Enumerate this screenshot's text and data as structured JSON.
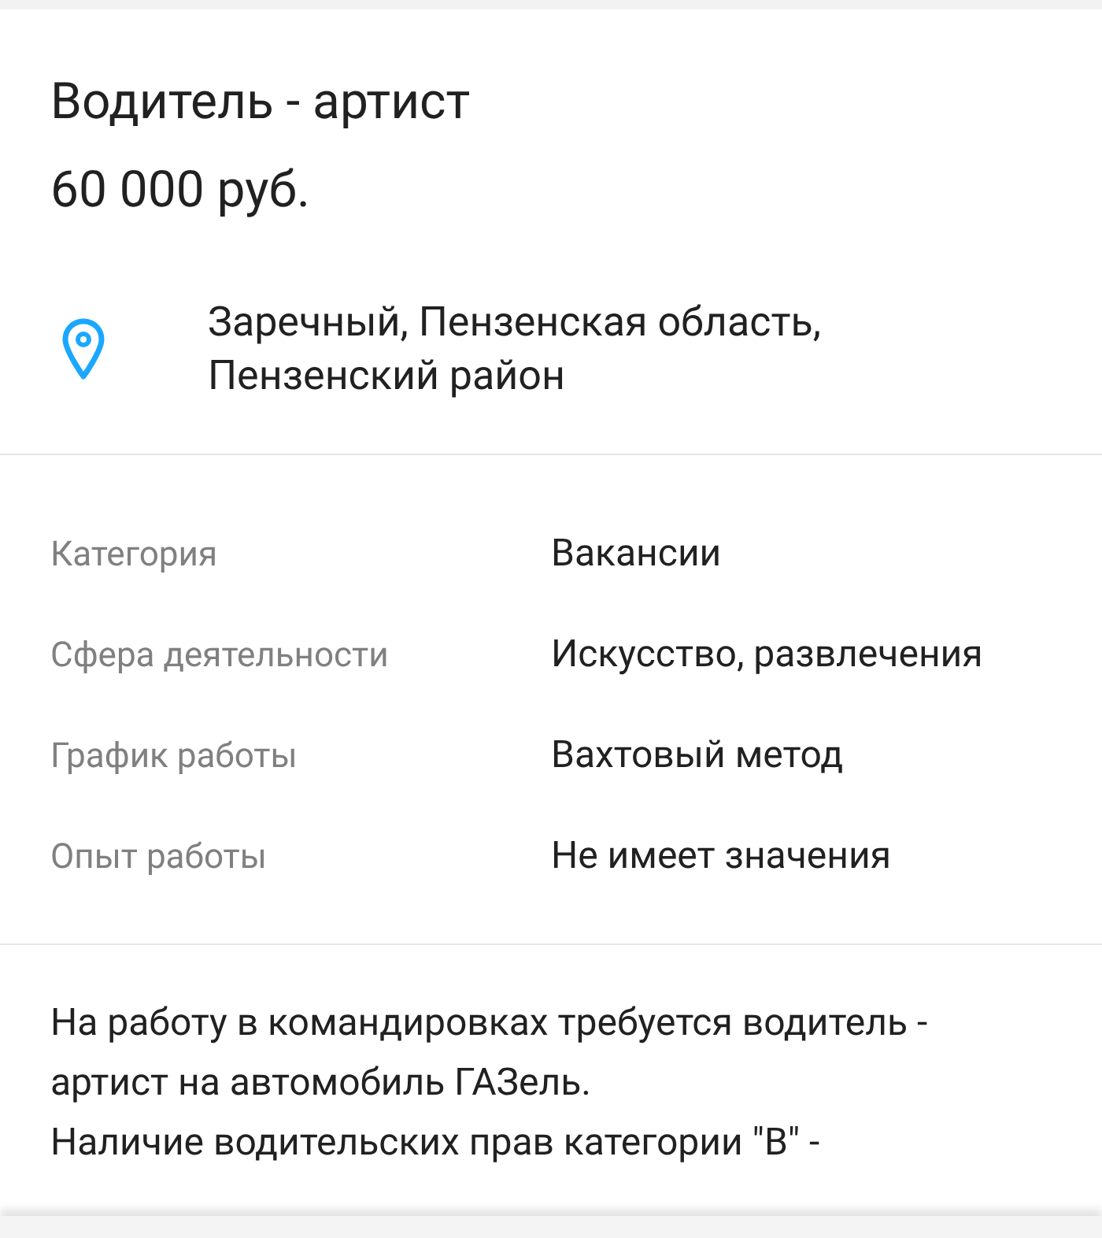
{
  "title": "Водитель - артист",
  "price": "60 000 руб.",
  "location": {
    "lines": [
      "Заречный, Пензенская область,",
      "Пензенский район"
    ]
  },
  "details": [
    {
      "label": "Категория",
      "value": "Вакансии"
    },
    {
      "label": "Сфера деятельности",
      "value": "Искусство, развлечения"
    },
    {
      "label": "График работы",
      "value": "Вахтовый метод"
    },
    {
      "label": "Опыт работы",
      "value": "Не имеет значения"
    }
  ],
  "description": [
    "На работу в командировках требуется водитель - артист на автомобиль ГАЗель.",
    "Наличие водительских прав категории \"B\" -"
  ]
}
